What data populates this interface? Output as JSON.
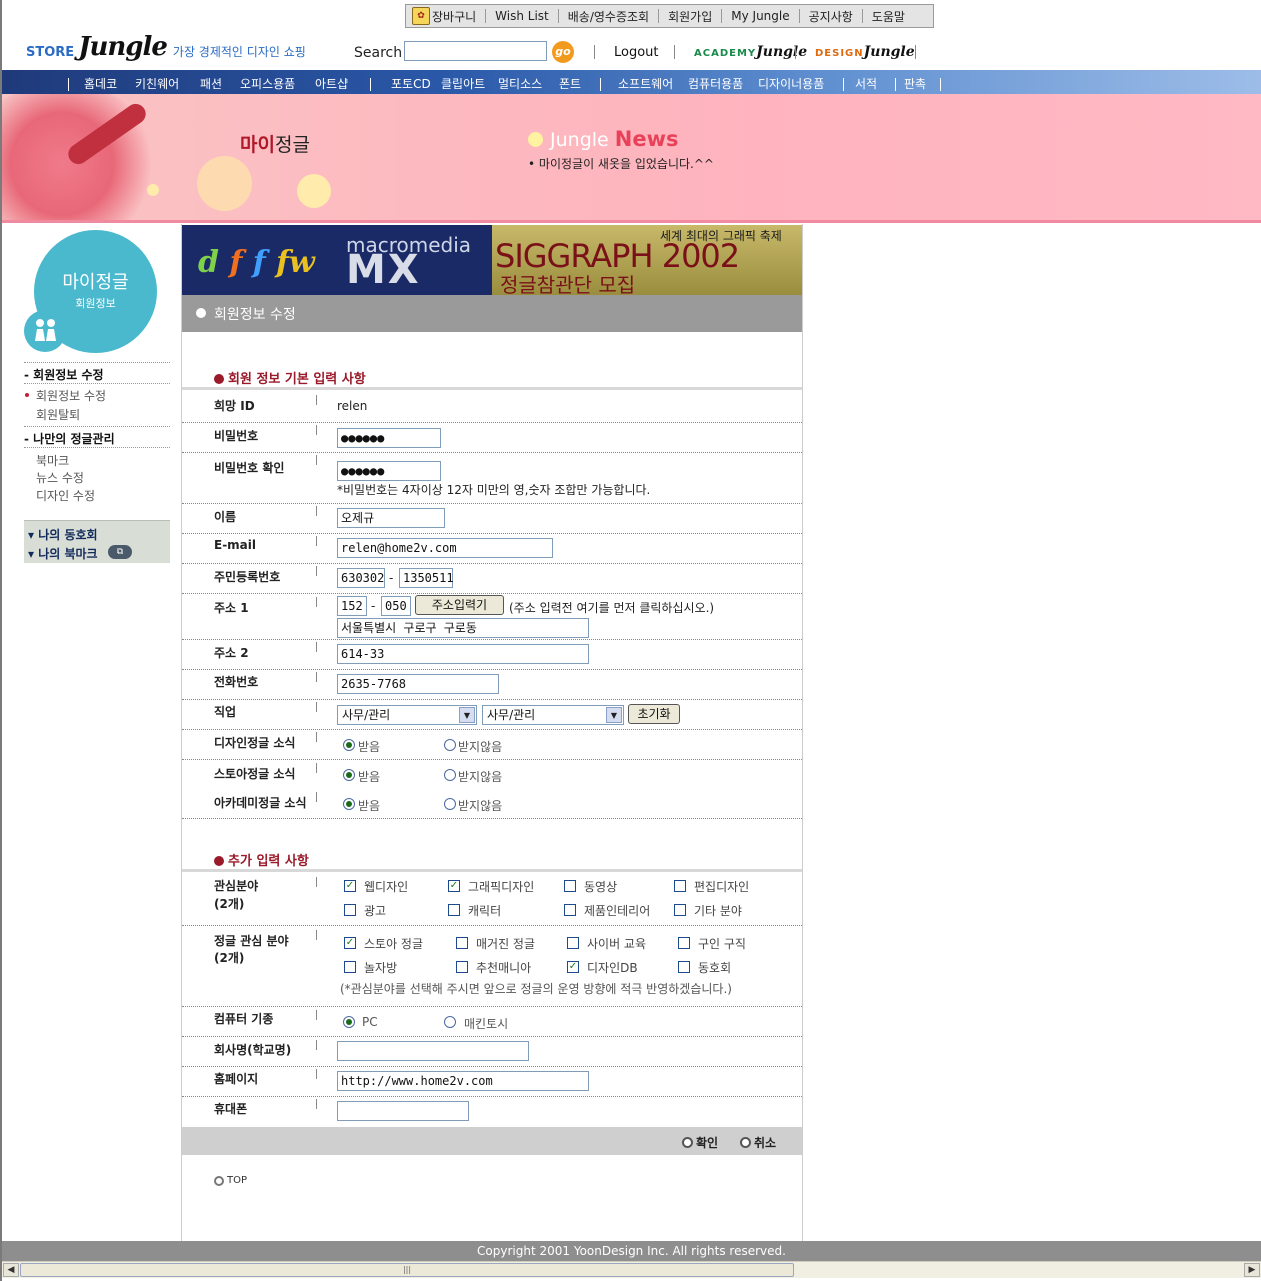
{
  "top_nav": {
    "cart": "장바구니",
    "items": [
      "Wish List",
      "배송/영수증조회",
      "회원가입",
      "My Jungle",
      "공지사항",
      "도움말"
    ]
  },
  "header": {
    "logo_store": "STORE",
    "logo_jungle": "Jungle",
    "tagline": "가장 경제적인 디자인 쇼핑",
    "search_label": "Search",
    "search_value": "",
    "go_label": "go",
    "logout": "Logout",
    "academy_pre": "ACADEMY",
    "design_pre": "DESIGN",
    "jungle_word": "Jungle"
  },
  "main_nav": [
    "홈데코",
    "키친웨어",
    "패션",
    "오피스용품",
    "아트샵",
    "포토CD",
    "클립아트",
    "멀티소스",
    "폰트",
    "소프트웨어",
    "컴퓨터용품",
    "디자이너용품",
    "서적",
    "판촉"
  ],
  "banner": {
    "title_bold": "마이",
    "title_rest": "정글",
    "news_small": "Jungle ",
    "news_big": "News",
    "news_item": "마이정글이 새옷을 입었습니다.^^"
  },
  "sidebar": {
    "circle_title": "마이정글",
    "circle_sub": "회원정보",
    "group1": "- 회원정보 수정",
    "group1_items": [
      "회원정보 수정",
      "회원탈퇴"
    ],
    "group2": "- 나만의 정글관리",
    "group2_items": [
      "북마크",
      "뉴스 수정",
      "디자인 수정"
    ],
    "box_items": [
      "나의 동호회",
      "나의 북마크"
    ]
  },
  "ad": {
    "macromedia": "macromedia",
    "mx": "MX",
    "tagline": "세계 최대의 그래픽 축제",
    "siggraph": "SIGGRAPH 2002",
    "recruit": "정글참관단 모집"
  },
  "section_title": "회원정보 수정",
  "basic": {
    "heading": "회원 정보 기본 입력 사항",
    "id_label": "희망 ID",
    "id_value": "relen",
    "pw_label": "비밀번호",
    "pw_value": "●●●●●●",
    "pw2_label": "비밀번호 확인",
    "pw2_value": "●●●●●●",
    "pw_note": "*비밀번호는 4자이상 12자 미만의 영,숫자 조합만 가능합니다.",
    "name_label": "이름",
    "name_value": "오제규",
    "email_label": "E-mail",
    "email_value": "relen@home2v.com",
    "ssn_label": "주민등록번호",
    "ssn1": "630302",
    "ssn_dash": "-",
    "ssn2": "1350511",
    "addr1_label": "주소 1",
    "zip1": "152",
    "zip2": "050",
    "addr_btn": "주소입력기",
    "addr_note": "(주소 입력전 여기를 먼저 클릭하십시오.)",
    "addr1_value": "서울특별시 구로구 구로동",
    "addr2_label": "주소 2",
    "addr2_value": "614-33",
    "phone_label": "전화번호",
    "phone_value": "2635-7768",
    "job_label": "직업",
    "job1": "사무/관리",
    "job2": "사무/관리",
    "reset_btn": "초기화",
    "news_rows": [
      {
        "label": "디자인정글 소식",
        "yes": "받음",
        "no": "받지않음"
      },
      {
        "label": "스토아정글 소식",
        "yes": "받음",
        "no": "받지않음"
      },
      {
        "label": "아카데미정글 소식",
        "yes": "받음",
        "no": "받지않음"
      }
    ]
  },
  "extra": {
    "heading": "추가 입력 사항",
    "interest_label": "관심분야",
    "interest_sub": "(2개)",
    "interests": [
      {
        "label": "웹디자인",
        "checked": true
      },
      {
        "label": "그래픽디자인",
        "checked": true
      },
      {
        "label": "동영상",
        "checked": false
      },
      {
        "label": "편집디자인",
        "checked": false
      },
      {
        "label": "광고",
        "checked": false
      },
      {
        "label": "캐릭터",
        "checked": false
      },
      {
        "label": "제품인테리어",
        "checked": false
      },
      {
        "label": "기타 분야",
        "checked": false
      }
    ],
    "jungle_label": "정글 관심 분야",
    "jungle_sub": "(2개)",
    "jungle_interests": [
      {
        "label": "스토아 정글",
        "checked": true
      },
      {
        "label": "매거진 정글",
        "checked": false
      },
      {
        "label": "사이버 교육",
        "checked": false
      },
      {
        "label": "구인 구직",
        "checked": false
      },
      {
        "label": "놀자방",
        "checked": false
      },
      {
        "label": "추천매니아",
        "checked": false
      },
      {
        "label": "디자인DB",
        "checked": true
      },
      {
        "label": "동호회",
        "checked": false
      }
    ],
    "jungle_note": "(*관심분야를 선택해 주시면 앞으로 정글의 운영 방향에 적극 반영하겠습니다.)",
    "computer_label": "컴퓨터 기종",
    "pc": "PC",
    "mac": "매킨토시",
    "company_label": "회사명(학교명)",
    "company_value": "",
    "homepage_label": "홈페이지",
    "homepage_value": "http://www.home2v.com",
    "mobile_label": "휴대폰",
    "mobile_value": ""
  },
  "actions": {
    "confirm": "확인",
    "cancel": "취소"
  },
  "top_link": "TOP",
  "footer": "Copyright 2001 YoonDesign Inc. All rights reserved."
}
